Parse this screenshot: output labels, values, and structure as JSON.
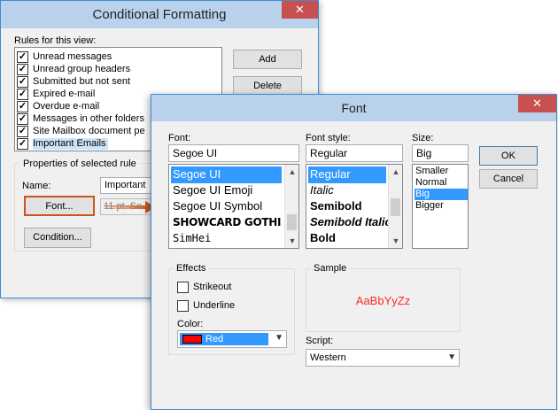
{
  "cf_dialog": {
    "title": "Conditional Formatting",
    "close_glyph": "✕",
    "rules_label": "Rules for this view:",
    "rules": [
      {
        "label": "Unread messages",
        "checked": true
      },
      {
        "label": "Unread group headers",
        "checked": true
      },
      {
        "label": "Submitted but not sent",
        "checked": true
      },
      {
        "label": "Expired e-mail",
        "checked": true
      },
      {
        "label": "Overdue e-mail",
        "checked": true
      },
      {
        "label": "Messages in other folders",
        "checked": true
      },
      {
        "label": "Site Mailbox document pe",
        "checked": true
      },
      {
        "label": "Important Emails",
        "checked": true
      }
    ],
    "check_glyph": "✓",
    "add_label": "Add",
    "delete_label": "Delete",
    "props_label": "Properties of selected rule",
    "name_label": "Name:",
    "name_value": "Important",
    "font_button": "Font...",
    "font_preview": "11 pt. Se",
    "condition_button": "Condition..."
  },
  "font_dialog": {
    "title": "Font",
    "close_glyph": "✕",
    "font_label": "Font:",
    "font_value": "Segoe UI",
    "fonts": [
      "Segoe UI",
      "Segoe UI Emoji",
      "Segoe UI Symbol",
      "SHOWCARD GOTHI",
      "SimHei"
    ],
    "selected_font": "Segoe UI",
    "style_label": "Font style:",
    "style_value": "Regular",
    "styles": [
      "Regular",
      "Italic",
      "Semibold",
      "Semibold Italic",
      "Bold"
    ],
    "selected_style": "Regular",
    "size_label": "Size:",
    "size_value": "Big",
    "sizes": [
      "Smaller",
      "Normal",
      "Big",
      "Bigger"
    ],
    "selected_size": "Big",
    "ok_label": "OK",
    "cancel_label": "Cancel",
    "effects_label": "Effects",
    "strikeout_label": "Strikeout",
    "underline_label": "Underline",
    "strikeout_checked": false,
    "underline_checked": false,
    "color_label": "Color:",
    "color_value": "Red",
    "color_hex": "#ff0000",
    "sample_label": "Sample",
    "sample_text": "AaBbYyZz",
    "script_label": "Script:",
    "script_value": "Western"
  },
  "colors": {
    "titlebar": "#b9d1ea",
    "close_button": "#c75050",
    "selection": "#3399ff",
    "font_button_border": "#c8561e",
    "arrow": "#c8561e"
  }
}
